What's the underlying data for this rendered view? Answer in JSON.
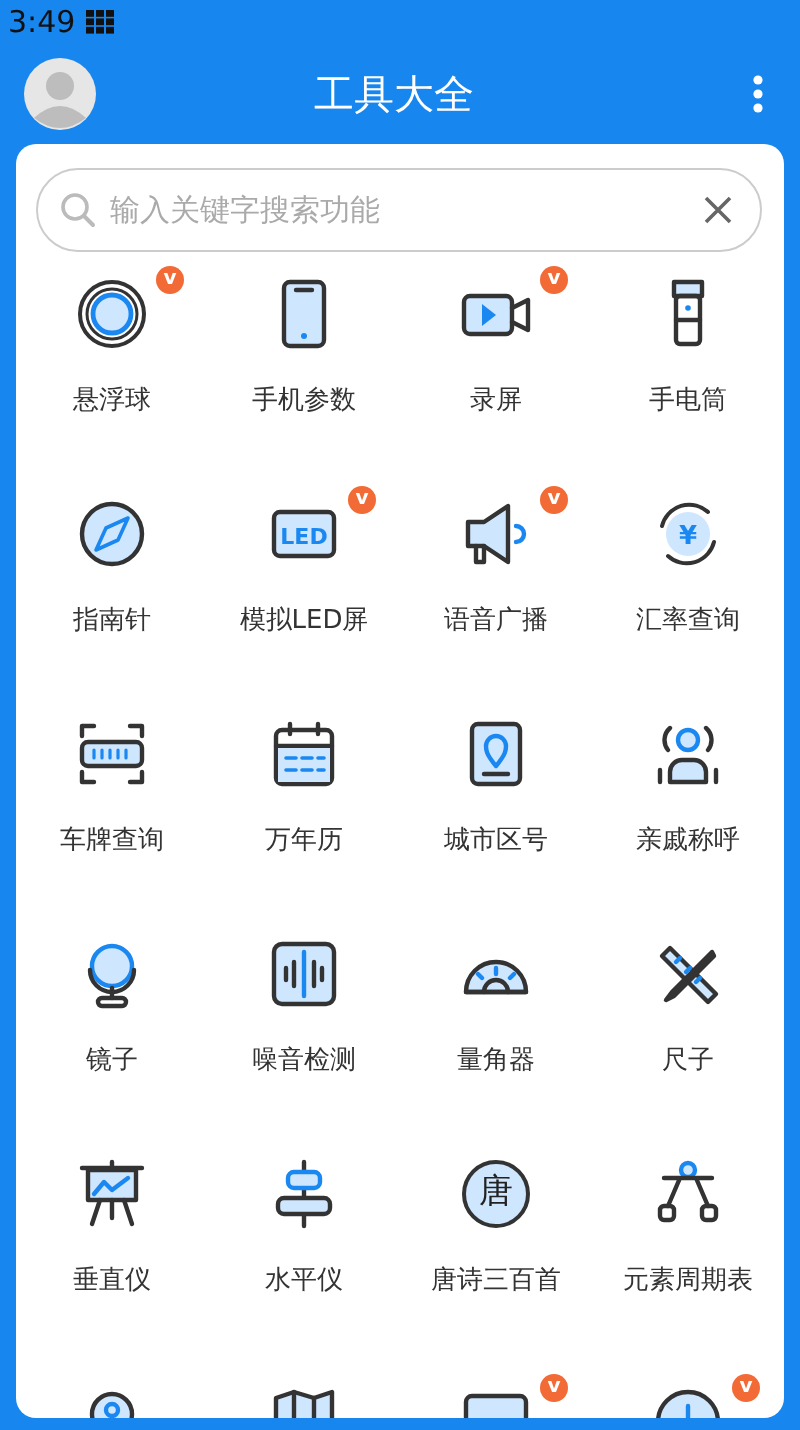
{
  "status_bar": {
    "time": "3:49"
  },
  "header": {
    "title": "工具大全"
  },
  "search": {
    "placeholder": "输入关键字搜索功能"
  },
  "tools": [
    {
      "label": "悬浮球",
      "badge": "v"
    },
    {
      "label": "手机参数"
    },
    {
      "label": "录屏",
      "badge": "v"
    },
    {
      "label": "手电筒"
    },
    {
      "label": "指南针"
    },
    {
      "label": "模拟LED屏",
      "badge": "v",
      "icon_text": "LED"
    },
    {
      "label": "语音广播",
      "badge": "v"
    },
    {
      "label": "汇率查询",
      "icon_text": "¥"
    },
    {
      "label": "车牌查询"
    },
    {
      "label": "万年历"
    },
    {
      "label": "城市区号"
    },
    {
      "label": "亲戚称呼"
    },
    {
      "label": "镜子"
    },
    {
      "label": "噪音检测"
    },
    {
      "label": "量角器"
    },
    {
      "label": "尺子"
    },
    {
      "label": "垂直仪"
    },
    {
      "label": "水平仪"
    },
    {
      "label": "唐诗三百首",
      "icon_text": "唐"
    },
    {
      "label": "元素周期表"
    },
    {
      "kind": "partial"
    },
    {
      "kind": "partial"
    },
    {
      "kind": "partial",
      "badge": "v"
    },
    {
      "kind": "partial",
      "badge": "v"
    }
  ]
}
